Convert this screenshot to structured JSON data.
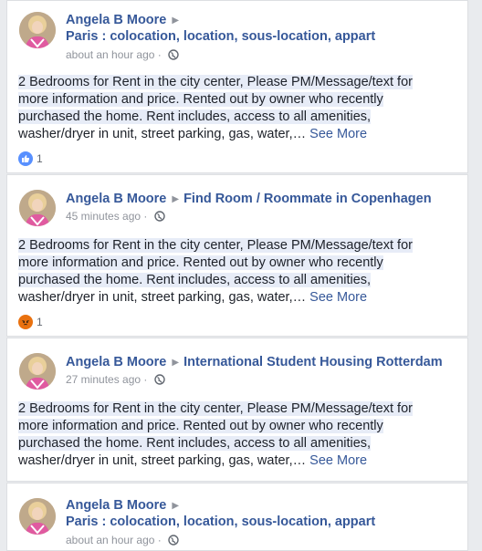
{
  "posts": [
    {
      "author": "Angela B Moore",
      "group": "Paris : colocation, location, sous-location, appart",
      "time": "about an hour ago",
      "lines": [
        "2 Bedrooms for Rent in the city center, Please PM/Message/text for",
        "more information and price. Rented out by owner who recently",
        "purchased the home. Rent includes, access to all amenities,",
        "washer/dryer in unit, street parking, gas, water,… "
      ],
      "see_more": "See More",
      "reaction_icon": "like-icon",
      "reaction_count": "1"
    },
    {
      "author": "Angela B Moore",
      "group": "Find Room / Roommate in Copenhagen",
      "time": "45 minutes ago",
      "lines": [
        "2 Bedrooms for Rent in the city center, Please PM/Message/text for",
        "more information and price. Rented out by owner who recently",
        "purchased the home. Rent includes, access to all amenities,",
        "washer/dryer in unit, street parking, gas, water,… "
      ],
      "see_more": "See More",
      "reaction_icon": "angry-icon",
      "reaction_count": "1"
    },
    {
      "author": "Angela B Moore",
      "group": "International Student Housing Rotterdam",
      "time": "27 minutes ago",
      "lines": [
        "2 Bedrooms for Rent in the city center, Please PM/Message/text for",
        "more information and price. Rented out by owner who recently",
        "purchased the home. Rent includes, access to all amenities,",
        "washer/dryer in unit, street parking, gas, water,… "
      ],
      "see_more": "See More"
    },
    {
      "author": "Angela B Moore",
      "group": "Paris : colocation, location, sous-location, appart",
      "time": "about an hour ago"
    }
  ],
  "colors": {
    "link": "#365899",
    "like": "#5890ff",
    "angry": "#e9710f"
  }
}
